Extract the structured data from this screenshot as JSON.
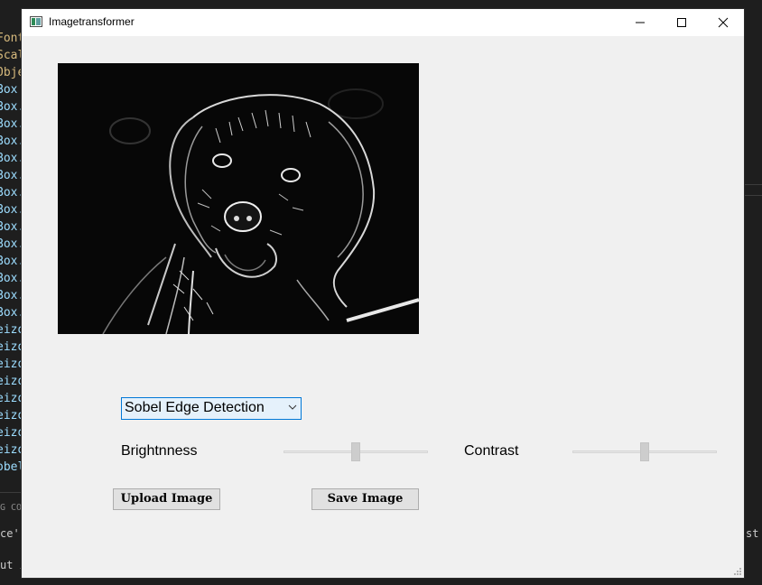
{
  "window": {
    "title": "Imagetransformer"
  },
  "controls": {
    "filter_dropdown_value": "Sobel Edge Detection",
    "brightness_label": "Brightnness",
    "contrast_label": "Contrast",
    "brightness_level": 0.5,
    "contrast_level": 0.5,
    "upload_button": "Upload Image",
    "save_button": "Save Image"
  },
  "background_editor": {
    "code_lines": [
      {
        "text": "Font",
        "color": "#d7ba7d"
      },
      {
        "text": "Scal",
        "color": "#d7ba7d"
      },
      {
        "text": "Obje",
        "color": "#d7ba7d"
      },
      {
        "text": "Box",
        "color": "#9cdcfe"
      },
      {
        "text": "Box.",
        "color": "#9cdcfe"
      },
      {
        "text": "Box.",
        "color": "#9cdcfe"
      },
      {
        "text": "Box.",
        "color": "#9cdcfe"
      },
      {
        "text": "Box.",
        "color": "#9cdcfe"
      },
      {
        "text": "Box.",
        "color": "#9cdcfe"
      },
      {
        "text": "Box.",
        "color": "#9cdcfe"
      },
      {
        "text": "Box.",
        "color": "#9cdcfe"
      },
      {
        "text": "Box.",
        "color": "#9cdcfe"
      },
      {
        "text": "Box.",
        "color": "#9cdcfe"
      },
      {
        "text": "Box.",
        "color": "#9cdcfe"
      },
      {
        "text": "Box.",
        "color": "#9cdcfe"
      },
      {
        "text": "Box.",
        "color": "#9cdcfe"
      },
      {
        "text": "Box.",
        "color": "#9cdcfe"
      },
      {
        "text": "eizo",
        "color": "#9cdcfe"
      },
      {
        "text": "eizo",
        "color": "#9cdcfe"
      },
      {
        "text": "eizo",
        "color": "#9cdcfe"
      },
      {
        "text": "eizo",
        "color": "#9cdcfe"
      },
      {
        "text": "eizo",
        "color": "#9cdcfe"
      },
      {
        "text": "eizo",
        "color": "#9cdcfe"
      },
      {
        "text": "eizo",
        "color": "#9cdcfe"
      },
      {
        "text": "eizo",
        "color": "#9cdcfe"
      },
      {
        "text": "obel",
        "color": "#9cdcfe"
      }
    ],
    "terminal_header": "G CO",
    "terminal_line_1": "ce'",
    "terminal_line_2": "ut i",
    "terminal_right": "st"
  }
}
